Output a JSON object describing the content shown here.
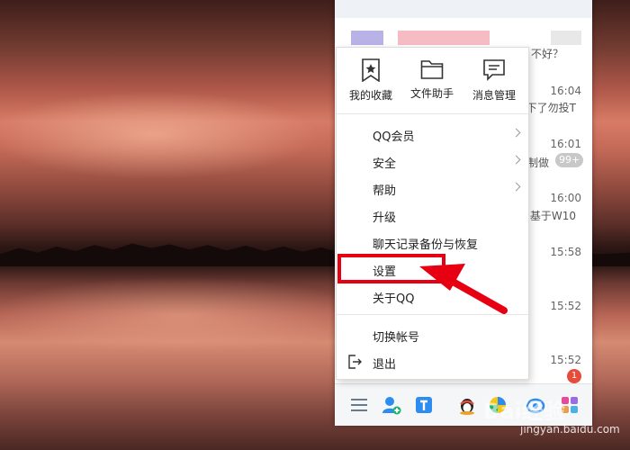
{
  "menu": {
    "quick_actions": [
      {
        "label": "我的收藏",
        "icon": "star-bookmark-icon"
      },
      {
        "label": "文件助手",
        "icon": "folder-icon"
      },
      {
        "label": "消息管理",
        "icon": "chat-bubble-icon"
      }
    ],
    "items": [
      {
        "label": "QQ会员",
        "has_submenu": true
      },
      {
        "label": "安全",
        "has_submenu": true
      },
      {
        "label": "帮助",
        "has_submenu": true
      },
      {
        "label": "升级",
        "has_submenu": false
      },
      {
        "label": "聊天记录备份与恢复",
        "has_submenu": false
      },
      {
        "label": "设置",
        "has_submenu": false,
        "highlighted": true
      },
      {
        "label": "关于QQ",
        "has_submenu": false
      }
    ],
    "account_items": [
      {
        "label": "切换帐号"
      },
      {
        "label": "退出",
        "icon": "logout-icon"
      }
    ]
  },
  "contacts": {
    "previews": [
      "不好？",
      "下了勿投T",
      "制做",
      "基于W10"
    ],
    "times": [
      "16:04",
      "16:01",
      "16:00",
      "15:58",
      "15:52",
      "15:52"
    ],
    "badges": {
      "unread_many": "99+",
      "unread_one": "1"
    }
  },
  "annotation": {
    "color": "#e60012"
  },
  "watermark": {
    "text": "Bai经验",
    "url": "jingyan.baidu.com"
  },
  "colors": {
    "accent_blue": "#2d8cf0",
    "badge_red": "#e64b3b",
    "annotation_red": "#e60012"
  }
}
